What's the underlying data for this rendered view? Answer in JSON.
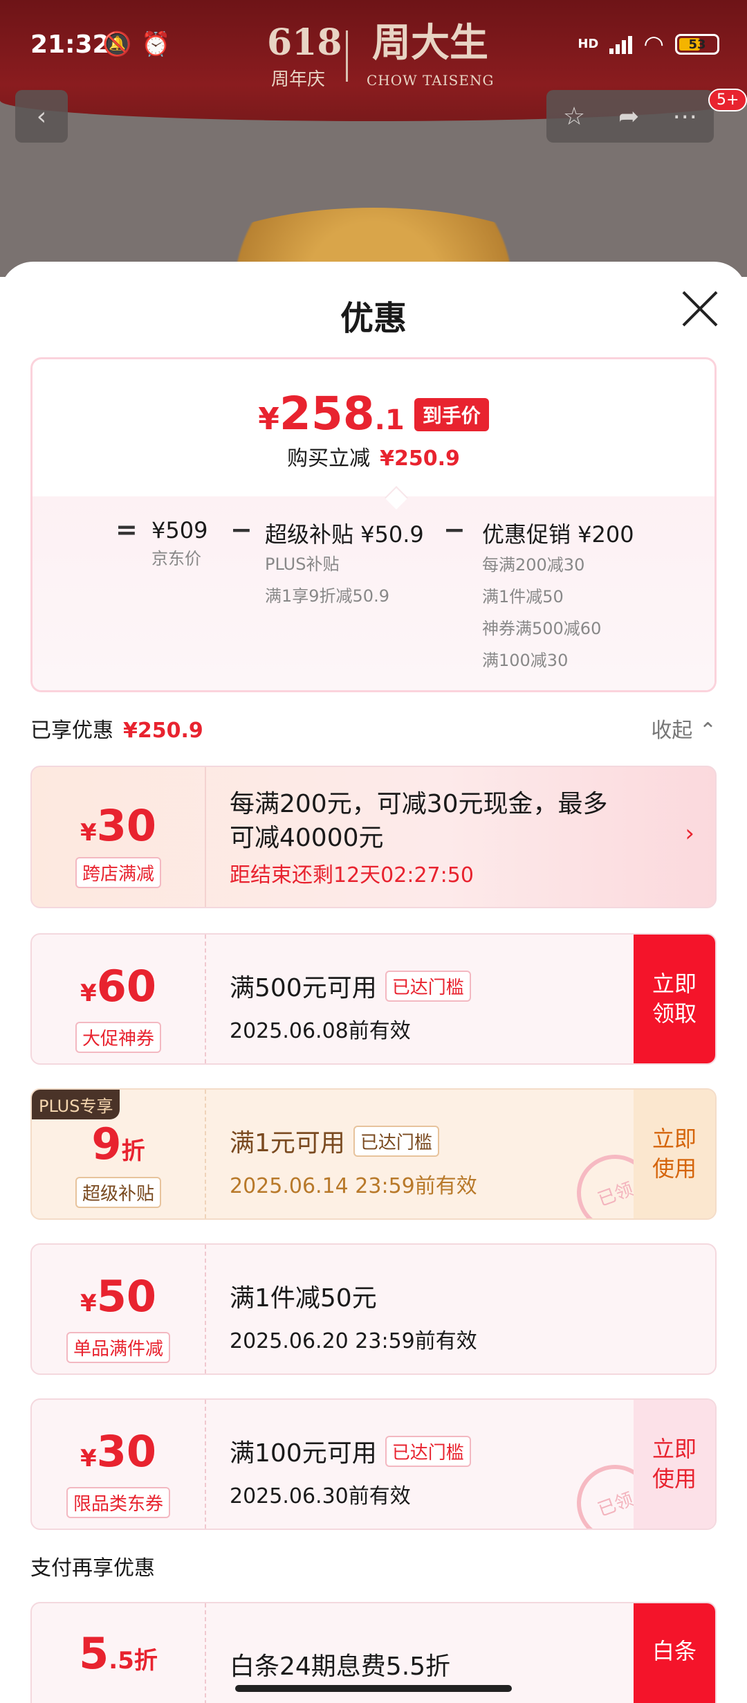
{
  "status": {
    "time": "21:32",
    "net_label": "HD",
    "battery": "53"
  },
  "banner": {
    "brand_618": "618",
    "brand_sub": "周年庆",
    "brand_cn": "周大生",
    "brand_en": "CHOW TAISENG"
  },
  "nav": {
    "badge": "5+"
  },
  "sheet": {
    "title": "优惠"
  },
  "price": {
    "currency": "¥",
    "main": "258",
    "decimal": ".1",
    "tag": "到手价",
    "sub_label": "购买立减",
    "sub_value": "¥250.9",
    "eq": "=",
    "minus": "−",
    "jd_value": "¥509",
    "jd_label": "京东价",
    "subsidy_title": "超级补贴 ¥50.9",
    "subsidy_line1": "PLUS补贴",
    "subsidy_line2": "满1享9折减50.9",
    "promo_title": "优惠促销 ¥200",
    "promo_line1": "每满200减30",
    "promo_line2": "满1件减50",
    "promo_line3": "神券满500减60",
    "promo_line4": "满100减30"
  },
  "enjoyed": {
    "label": "已享优惠",
    "value": "¥250.9",
    "collapse": "收起 ⌃"
  },
  "coupons": [
    {
      "cur": "¥",
      "amount": "30",
      "type": "跨店满减",
      "line1": "每满200元，可减30元现金，最多可减40000元",
      "line2": "距结束还剩12天02:27:50"
    },
    {
      "cur": "¥",
      "amount": "60",
      "type": "大促神券",
      "line1": "满500元可用",
      "reach": "已达门槛",
      "line2": "2025.06.08前有效",
      "action": "立即领取"
    },
    {
      "plus": "PLUS专享",
      "amount": "9",
      "unit": "折",
      "type": "超级补贴",
      "line1": "满1元可用",
      "reach": "已达门槛",
      "line2": "2025.06.14 23:59前有效",
      "action": "立即使用",
      "stamp": "已领"
    },
    {
      "cur": "¥",
      "amount": "50",
      "type": "单品满件减",
      "line1": "满1件减50元",
      "line2": "2025.06.20 23:59前有效"
    },
    {
      "cur": "¥",
      "amount": "30",
      "type": "限品类东券",
      "line1": "满100元可用",
      "reach": "已达门槛",
      "line2": "2025.06.30前有效",
      "action": "立即使用",
      "stamp": "已领"
    }
  ],
  "pay": {
    "label": "支付再享优惠",
    "amount": "5",
    "decimal": ".5折",
    "line1": "白条24期息费5.5折",
    "action": "白条"
  }
}
